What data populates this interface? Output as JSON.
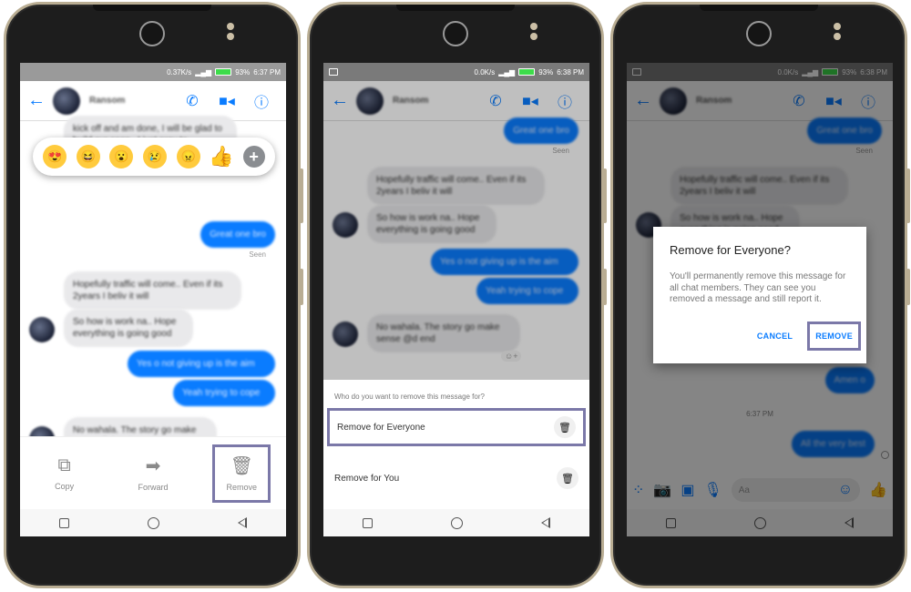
{
  "phones": [
    {
      "status": {
        "speed": "0.37K/s",
        "battery": "93%",
        "time": "6:37 PM"
      },
      "header": {
        "contact_name": "Ransom"
      },
      "messages": [
        {
          "from": "in",
          "text": "kick off and am done, I will be glad to build our soon.. I just pray to"
        },
        {
          "from": "out",
          "text": "Great one bro"
        },
        {
          "from": "in",
          "text": "Hopefully traffic will come.. Even if its 2years I beliv it will"
        },
        {
          "from": "in",
          "text": "So how is work na.. Hope everything is going good"
        },
        {
          "from": "out",
          "text": "Yes o not giving up is the aim"
        },
        {
          "from": "out",
          "text": "Yeah trying to cope"
        },
        {
          "from": "in",
          "text": "No wahala. The story go make sense @d end"
        }
      ],
      "seen_label": "Seen",
      "react_add": "☺+",
      "reactions": [
        "love-eyes",
        "laugh",
        "wow",
        "sad",
        "angry",
        "thumbs-up",
        "more"
      ],
      "reaction_glyphs": [
        "😍",
        "😆",
        "😮",
        "😢",
        "😠",
        "👍",
        "+"
      ],
      "actions": [
        {
          "label": "Copy",
          "icon": "⧉"
        },
        {
          "label": "Forward",
          "icon": "➡"
        },
        {
          "label": "Remove",
          "icon": "🗑"
        }
      ]
    },
    {
      "status": {
        "speed": "0.0K/s",
        "battery": "93%",
        "time": "6:38 PM"
      },
      "header": {
        "contact_name": "Ransom"
      },
      "messages": [
        {
          "from": "out",
          "text": "Great one bro"
        },
        {
          "from": "in",
          "text": "Hopefully traffic will come.. Even if its 2years I beliv it will"
        },
        {
          "from": "in",
          "text": "So how is work na.. Hope everything is going good"
        },
        {
          "from": "out",
          "text": "Yes o not giving up is the aim"
        },
        {
          "from": "out",
          "text": "Yeah trying to cope"
        },
        {
          "from": "in",
          "text": "No wahala. The story go make sense @d end"
        }
      ],
      "seen_label": "Seen",
      "react_add": "☺+",
      "sheet": {
        "question": "Who do you want to remove this message for?",
        "options": [
          "Remove for Everyone",
          "Remove for You"
        ]
      }
    },
    {
      "status": {
        "speed": "0.0K/s",
        "battery": "93%",
        "time": "6:38 PM"
      },
      "header": {
        "contact_name": "Ransom"
      },
      "messages": [
        {
          "from": "out",
          "text": "Great one bro"
        },
        {
          "from": "in",
          "text": "Hopefully traffic will come.. Even if its 2years I beliv it will"
        },
        {
          "from": "in",
          "text": "So how is work na.. Hope everything is going good"
        },
        {
          "from": "out",
          "text": "Amen o"
        },
        {
          "from": "out",
          "text": "All the very best"
        }
      ],
      "seen_label": "Seen",
      "timestamp": "6:37 PM",
      "dialog": {
        "title": "Remove for Everyone?",
        "body": "You'll permanently remove this message for all chat members. They can see you removed a message and still report it.",
        "cancel": "CANCEL",
        "confirm": "REMOVE"
      },
      "composer": {
        "placeholder": "Aa"
      }
    }
  ]
}
